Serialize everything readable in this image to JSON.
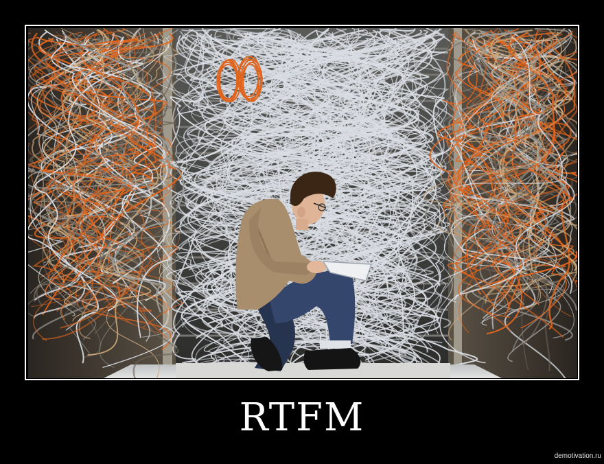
{
  "caption": "RTFM",
  "watermark": "demotivation.ru",
  "colors": {
    "background": "#000000",
    "frame_border": "#ffffff",
    "caption_text": "#ffffff",
    "cable_white": "#d9dde3",
    "cable_orange": "#e0651e",
    "rack_metal": "#8f8b82",
    "sweater": "#a48a6a",
    "jeans": "#2e3d5c"
  },
  "photo": {
    "subject": "man kneeling reading a manual",
    "setting": "server room with tangled network cables"
  }
}
